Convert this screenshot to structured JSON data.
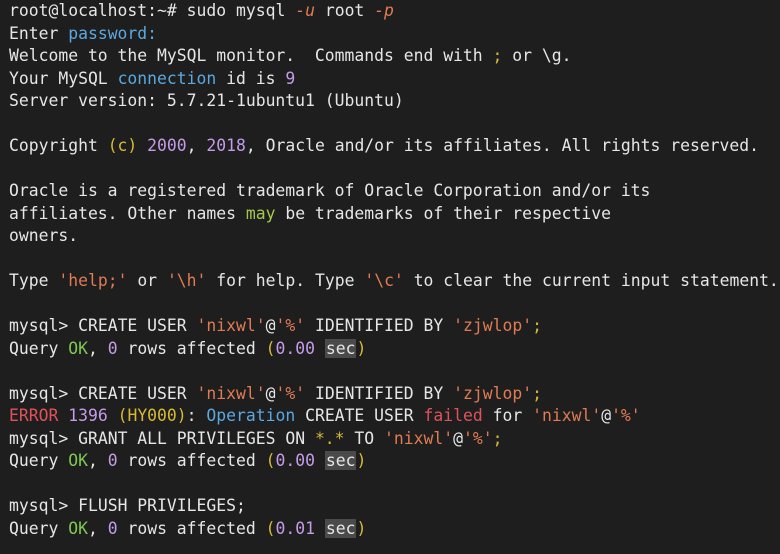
{
  "terminal": {
    "prompt": "root@localhost:~#",
    "command": "sudo mysql",
    "flag_u": "-u",
    "user": "root",
    "flag_p": "-p",
    "enter": "Enter",
    "password": "password",
    "colon": ":",
    "welcome_a": "Welcome to the MySQL monitor.  Commands end with",
    "welcome_semi": ";",
    "welcome_b": "or \\g.",
    "conn_a": "Your MySQL",
    "conn_kw": "connection",
    "conn_b": "id is",
    "conn_id": "9",
    "server_a": "Server version: 5.7.21-1ubuntu1 (Ubuntu)",
    "copy_a": "Copyright",
    "copy_c": "(c)",
    "copy_y1": "2000",
    "copy_comma": ",",
    "copy_y2": "2018",
    "copy_b": ", Oracle and/or its affiliates. All rights reserved.",
    "tm1": "Oracle is a registered trademark of Oracle Corporation and/or its",
    "tm2a": "affiliates. Other names",
    "tm2may": "may",
    "tm2b": "be trademarks of their respective",
    "tm3": "owners.",
    "help_a": "Type",
    "help_s1": "'help;'",
    "help_b": "or",
    "help_s2": "'\\h'",
    "help_c": "for help. Type",
    "help_s3": "'\\c'",
    "help_d": "to clear the current input statement.",
    "mysql_prompt": "mysql>",
    "create_user": "CREATE USER",
    "user_str": "'nixwl'",
    "at": "@",
    "host_str": "'%'",
    "identified": "IDENTIFIED BY",
    "pass_str": "'zjwlop'",
    "semi": ";",
    "query": "Query",
    "ok": "OK",
    "comma": ",",
    "zero": "0",
    "rows": "rows affected",
    "lp": "(",
    "rp": ")",
    "t1": "0.00",
    "sec": "sec",
    "error": "ERROR",
    "err_code": "1396",
    "hy": "(HY000)",
    "err_colon": ":",
    "operation": "Operation",
    "create_user_err": "CREATE USER",
    "failed": "failed",
    "for": "for",
    "grant": "GRANT ALL PRIVILEGES ON",
    "star": "*.*",
    "to": "TO",
    "flush": "FLUSH PRIVILEGES;",
    "t3": "0.01"
  },
  "colors": {
    "background": "#1e1e1e",
    "text": "#e6e6e6",
    "flag": "#e07b53",
    "keyword_blue": "#5ba8e0",
    "number": "#b48ead",
    "ok_green": "#7ec850",
    "error_red": "#e0525a"
  }
}
